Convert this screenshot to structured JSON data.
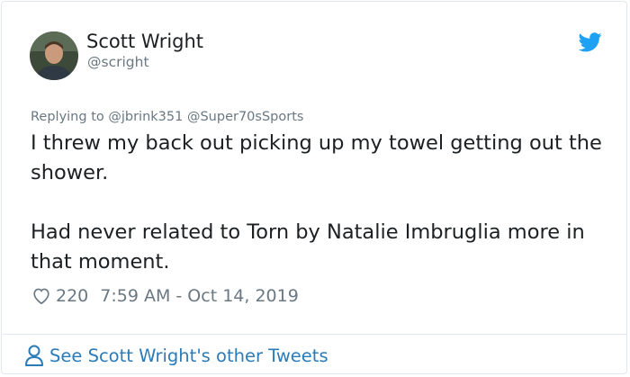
{
  "author": {
    "display_name": "Scott Wright",
    "handle": "@scright",
    "avatar_icon": "avatar-photo"
  },
  "brand": {
    "icon": "twitter-bird-icon",
    "color": "#1da1f2"
  },
  "reply_context": {
    "prefix": "Replying to",
    "mentions": [
      "@jbrink351",
      "@Super70sSports"
    ]
  },
  "tweet": {
    "paragraph_1": "I threw my back out picking up my towel getting out the shower.",
    "paragraph_2": "Had never related to Torn by Natalie Imbruglia more in that moment."
  },
  "meta": {
    "like_icon": "heart-icon",
    "like_count": "220",
    "timestamp": "7:59 AM - Oct 14, 2019"
  },
  "footer": {
    "icon": "person-icon",
    "link_text": "See Scott Wright's other Tweets",
    "link_color": "#2b7bb9"
  }
}
